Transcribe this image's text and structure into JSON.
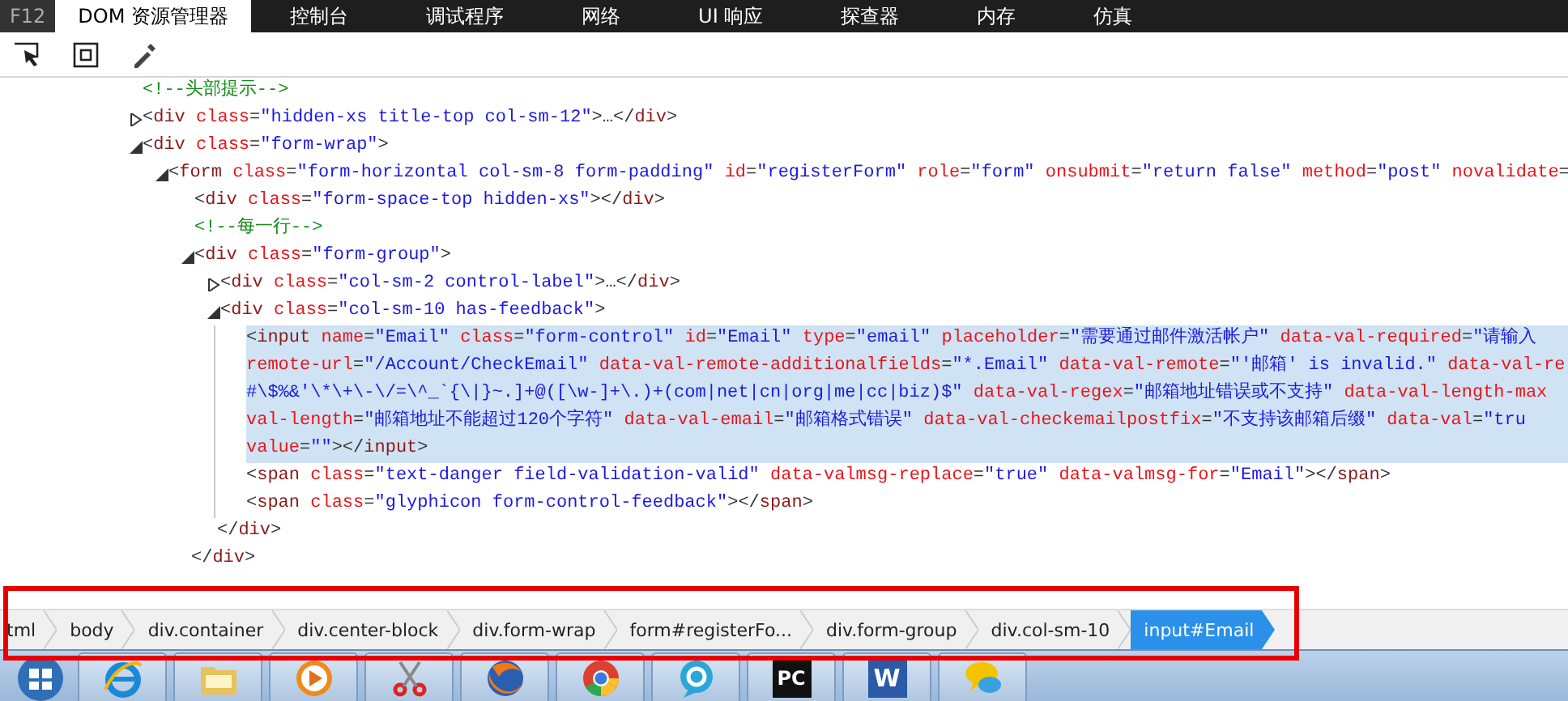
{
  "tabs": [
    {
      "label": "F12",
      "kind": "key",
      "selected": false
    },
    {
      "label": "DOM 资源管理器",
      "kind": "tab",
      "selected": true
    },
    {
      "label": "控制台",
      "kind": "tab",
      "selected": false
    },
    {
      "label": "调试程序",
      "kind": "tab",
      "selected": false
    },
    {
      "label": "网络",
      "kind": "tab",
      "selected": false
    },
    {
      "label": "UI 响应",
      "kind": "tab",
      "selected": false
    },
    {
      "label": "探查器",
      "kind": "tab",
      "selected": false
    },
    {
      "label": "内存",
      "kind": "tab",
      "selected": false
    },
    {
      "label": "仿真",
      "kind": "tab",
      "selected": false
    }
  ],
  "toolbar": [
    {
      "kind": "select"
    },
    {
      "kind": "box"
    },
    {
      "kind": "picker"
    }
  ],
  "dom_tree": [
    {
      "kind": "comment",
      "selected": false,
      "lines": [
        [
          {
            "kind": "comment",
            "text": "<!--头部提示-->"
          }
        ]
      ]
    },
    {
      "kind": "element",
      "expanded": false,
      "selected": false,
      "lines": [
        [
          {
            "kind": "punct",
            "text": "<"
          },
          {
            "kind": "tag",
            "text": "div"
          },
          {
            "kind": "attr",
            "text": "class"
          },
          {
            "kind": "punct",
            "text": "="
          },
          {
            "kind": "value",
            "text": "\"hidden-xs title-top col-sm-12\""
          },
          {
            "kind": "punct",
            "text": ">…</"
          },
          {
            "kind": "tag",
            "text": "div"
          },
          {
            "kind": "punct",
            "text": ">"
          }
        ]
      ]
    },
    {
      "kind": "element",
      "expanded": true,
      "selected": false,
      "lines": [
        [
          {
            "kind": "punct",
            "text": "<"
          },
          {
            "kind": "tag",
            "text": "div"
          },
          {
            "kind": "attr",
            "text": "class"
          },
          {
            "kind": "punct",
            "text": "="
          },
          {
            "kind": "value",
            "text": "\"form-wrap\""
          },
          {
            "kind": "punct",
            "text": ">"
          }
        ]
      ],
      "children": [
        {
          "kind": "element",
          "expanded": true,
          "selected": false,
          "lines": [
            [
              {
                "kind": "punct",
                "text": "<"
              },
              {
                "kind": "tag",
                "text": "form"
              },
              {
                "kind": "attr",
                "text": "class"
              },
              {
                "kind": "punct",
                "text": "="
              },
              {
                "kind": "value",
                "text": "\"form-horizontal col-sm-8 form-padding\""
              },
              {
                "kind": "attr",
                "text": "id"
              },
              {
                "kind": "punct",
                "text": "="
              },
              {
                "kind": "value",
                "text": "\"registerForm\""
              },
              {
                "kind": "attr",
                "text": "role"
              },
              {
                "kind": "punct",
                "text": "="
              },
              {
                "kind": "value",
                "text": "\"form\""
              },
              {
                "kind": "attr",
                "text": "onsubmit"
              },
              {
                "kind": "punct",
                "text": "="
              },
              {
                "kind": "value",
                "text": "\"return false\""
              },
              {
                "kind": "attr",
                "text": "method"
              },
              {
                "kind": "punct",
                "text": "="
              },
              {
                "kind": "value",
                "text": "\"post\""
              },
              {
                "kind": "attr",
                "text": "novalidate"
              },
              {
                "kind": "punct",
                "text": "="
              }
            ]
          ],
          "children": [
            {
              "kind": "element",
              "selected": false,
              "lines": [
                [
                  {
                    "kind": "punct",
                    "text": "<"
                  },
                  {
                    "kind": "tag",
                    "text": "div"
                  },
                  {
                    "kind": "attr",
                    "text": "class"
                  },
                  {
                    "kind": "punct",
                    "text": "="
                  },
                  {
                    "kind": "value",
                    "text": "\"form-space-top hidden-xs\""
                  },
                  {
                    "kind": "punct",
                    "text": "></"
                  },
                  {
                    "kind": "tag",
                    "text": "div"
                  },
                  {
                    "kind": "punct",
                    "text": ">"
                  }
                ]
              ]
            },
            {
              "kind": "comment",
              "selected": false,
              "lines": [
                [
                  {
                    "kind": "comment",
                    "text": "<!--每一行-->"
                  }
                ]
              ]
            },
            {
              "kind": "element",
              "expanded": true,
              "selected": false,
              "lines": [
                [
                  {
                    "kind": "punct",
                    "text": "<"
                  },
                  {
                    "kind": "tag",
                    "text": "div"
                  },
                  {
                    "kind": "attr",
                    "text": "class"
                  },
                  {
                    "kind": "punct",
                    "text": "="
                  },
                  {
                    "kind": "value",
                    "text": "\"form-group\""
                  },
                  {
                    "kind": "punct",
                    "text": ">"
                  }
                ]
              ],
              "children": [
                {
                  "kind": "element",
                  "expanded": false,
                  "selected": false,
                  "lines": [
                    [
                      {
                        "kind": "punct",
                        "text": "<"
                      },
                      {
                        "kind": "tag",
                        "text": "div"
                      },
                      {
                        "kind": "attr",
                        "text": "class"
                      },
                      {
                        "kind": "punct",
                        "text": "="
                      },
                      {
                        "kind": "value",
                        "text": "\"col-sm-2 control-label\""
                      },
                      {
                        "kind": "punct",
                        "text": ">…</"
                      },
                      {
                        "kind": "tag",
                        "text": "div"
                      },
                      {
                        "kind": "punct",
                        "text": ">"
                      }
                    ]
                  ]
                },
                {
                  "kind": "element",
                  "expanded": true,
                  "selected": false,
                  "lines": [
                    [
                      {
                        "kind": "punct",
                        "text": "<"
                      },
                      {
                        "kind": "tag",
                        "text": "div"
                      },
                      {
                        "kind": "attr",
                        "text": "class"
                      },
                      {
                        "kind": "punct",
                        "text": "="
                      },
                      {
                        "kind": "value",
                        "text": "\"col-sm-10 has-feedback\""
                      },
                      {
                        "kind": "punct",
                        "text": ">"
                      }
                    ]
                  ],
                  "children": [
                    {
                      "kind": "element",
                      "selected": true,
                      "lines": [
                        [
                          {
                            "kind": "punct",
                            "text": "<"
                          },
                          {
                            "kind": "tag",
                            "text": "input"
                          },
                          {
                            "kind": "attr",
                            "text": "name"
                          },
                          {
                            "kind": "punct",
                            "text": "="
                          },
                          {
                            "kind": "value",
                            "text": "\"Email\""
                          },
                          {
                            "kind": "attr",
                            "text": "class"
                          },
                          {
                            "kind": "punct",
                            "text": "="
                          },
                          {
                            "kind": "value",
                            "text": "\"form-control\""
                          },
                          {
                            "kind": "attr",
                            "text": "id"
                          },
                          {
                            "kind": "punct",
                            "text": "="
                          },
                          {
                            "kind": "value",
                            "text": "\"Email\""
                          },
                          {
                            "kind": "attr",
                            "text": "type"
                          },
                          {
                            "kind": "punct",
                            "text": "="
                          },
                          {
                            "kind": "value",
                            "text": "\"email\""
                          },
                          {
                            "kind": "attr",
                            "text": "placeholder"
                          },
                          {
                            "kind": "punct",
                            "text": "="
                          },
                          {
                            "kind": "value",
                            "text": "\"需要通过邮件激活帐户\""
                          },
                          {
                            "kind": "attr",
                            "text": "data-val-required"
                          },
                          {
                            "kind": "punct",
                            "text": "="
                          },
                          {
                            "kind": "value",
                            "text": "\"请输入"
                          }
                        ],
                        [
                          {
                            "kind": "attr",
                            "text": "remote-url"
                          },
                          {
                            "kind": "punct",
                            "text": "="
                          },
                          {
                            "kind": "value",
                            "text": "\"/Account/CheckEmail\""
                          },
                          {
                            "kind": "attr",
                            "text": "data-val-remote-additionalfields"
                          },
                          {
                            "kind": "punct",
                            "text": "="
                          },
                          {
                            "kind": "value",
                            "text": "\"*.Email\""
                          },
                          {
                            "kind": "attr",
                            "text": "data-val-remote"
                          },
                          {
                            "kind": "punct",
                            "text": "="
                          },
                          {
                            "kind": "value",
                            "text": "\"'邮箱' is invalid.\""
                          },
                          {
                            "kind": "attr",
                            "text": "data-val-re"
                          }
                        ],
                        [
                          {
                            "kind": "value",
                            "text": "#\\$%&'\\*\\+\\-\\/=\\^_`{\\|}~.]+@([\\w-]+\\.)+(com|net|cn|org|me|cc|biz)$\""
                          },
                          {
                            "kind": "attr",
                            "text": "data-val-regex"
                          },
                          {
                            "kind": "punct",
                            "text": "="
                          },
                          {
                            "kind": "value",
                            "text": "\"邮箱地址错误或不支持\""
                          },
                          {
                            "kind": "attr",
                            "text": "data-val-length-max"
                          }
                        ],
                        [
                          {
                            "kind": "attr",
                            "text": "val-length"
                          },
                          {
                            "kind": "punct",
                            "text": "="
                          },
                          {
                            "kind": "value",
                            "text": "\"邮箱地址不能超过120个字符\""
                          },
                          {
                            "kind": "attr",
                            "text": "data-val-email"
                          },
                          {
                            "kind": "punct",
                            "text": "="
                          },
                          {
                            "kind": "value",
                            "text": "\"邮箱格式错误\""
                          },
                          {
                            "kind": "attr",
                            "text": "data-val-checkemailpostfix"
                          },
                          {
                            "kind": "punct",
                            "text": "="
                          },
                          {
                            "kind": "value",
                            "text": "\"不支持该邮箱后缀\""
                          },
                          {
                            "kind": "attr",
                            "text": "data-val"
                          },
                          {
                            "kind": "punct",
                            "text": "="
                          },
                          {
                            "kind": "value",
                            "text": "\"tru"
                          }
                        ],
                        [
                          {
                            "kind": "attr",
                            "text": "value"
                          },
                          {
                            "kind": "punct",
                            "text": "="
                          },
                          {
                            "kind": "value",
                            "text": "\"\""
                          },
                          {
                            "kind": "punct",
                            "text": "></"
                          },
                          {
                            "kind": "tag",
                            "text": "input"
                          },
                          {
                            "kind": "punct",
                            "text": ">"
                          }
                        ]
                      ]
                    },
                    {
                      "kind": "element",
                      "selected": false,
                      "lines": [
                        [
                          {
                            "kind": "punct",
                            "text": "<"
                          },
                          {
                            "kind": "tag",
                            "text": "span"
                          },
                          {
                            "kind": "attr",
                            "text": "class"
                          },
                          {
                            "kind": "punct",
                            "text": "="
                          },
                          {
                            "kind": "value",
                            "text": "\"text-danger field-validation-valid\""
                          },
                          {
                            "kind": "attr",
                            "text": "data-valmsg-replace"
                          },
                          {
                            "kind": "punct",
                            "text": "="
                          },
                          {
                            "kind": "value",
                            "text": "\"true\""
                          },
                          {
                            "kind": "attr",
                            "text": "data-valmsg-for"
                          },
                          {
                            "kind": "punct",
                            "text": "="
                          },
                          {
                            "kind": "value",
                            "text": "\"Email\""
                          },
                          {
                            "kind": "punct",
                            "text": "></"
                          },
                          {
                            "kind": "tag",
                            "text": "span"
                          },
                          {
                            "kind": "punct",
                            "text": ">"
                          }
                        ]
                      ]
                    },
                    {
                      "kind": "element",
                      "selected": false,
                      "lines": [
                        [
                          {
                            "kind": "punct",
                            "text": "<"
                          },
                          {
                            "kind": "tag",
                            "text": "span"
                          },
                          {
                            "kind": "attr",
                            "text": "class"
                          },
                          {
                            "kind": "punct",
                            "text": "="
                          },
                          {
                            "kind": "value",
                            "text": "\"glyphicon form-control-feedback\""
                          },
                          {
                            "kind": "punct",
                            "text": "></"
                          },
                          {
                            "kind": "tag",
                            "text": "span"
                          },
                          {
                            "kind": "punct",
                            "text": ">"
                          }
                        ]
                      ]
                    }
                  ]
                },
                {
                  "kind": "closing",
                  "selected": false,
                  "lines": [
                    [
                      {
                        "kind": "punct",
                        "text": "</"
                      },
                      {
                        "kind": "tag",
                        "text": "div"
                      },
                      {
                        "kind": "punct",
                        "text": ">"
                      }
                    ]
                  ]
                }
              ]
            },
            {
              "kind": "closing",
              "selected": false,
              "lines": [
                [
                  {
                    "kind": "punct",
                    "text": "</"
                  },
                  {
                    "kind": "tag",
                    "text": "div"
                  },
                  {
                    "kind": "punct",
                    "text": ">"
                  }
                ]
              ]
            }
          ]
        }
      ]
    }
  ],
  "breadcrumb": [
    {
      "label": "tml",
      "selected": false
    },
    {
      "label": "body",
      "selected": false
    },
    {
      "label": "div.container",
      "selected": false
    },
    {
      "label": "div.center-block",
      "selected": false
    },
    {
      "label": "div.form-wrap",
      "selected": false
    },
    {
      "label": "form#registerFo...",
      "selected": false
    },
    {
      "label": "div.form-group",
      "selected": false
    },
    {
      "label": "div.col-sm-10",
      "selected": false
    },
    {
      "label": "input#Email",
      "selected": true
    }
  ],
  "taskbar": [
    {
      "kind": "ie"
    },
    {
      "kind": "folder"
    },
    {
      "kind": "media"
    },
    {
      "kind": "scissors"
    },
    {
      "kind": "firefox"
    },
    {
      "kind": "chrome"
    },
    {
      "kind": "bubble-e"
    },
    {
      "kind": "ide",
      "label": "PC"
    },
    {
      "kind": "word",
      "label": "W"
    },
    {
      "kind": "chat"
    }
  ]
}
